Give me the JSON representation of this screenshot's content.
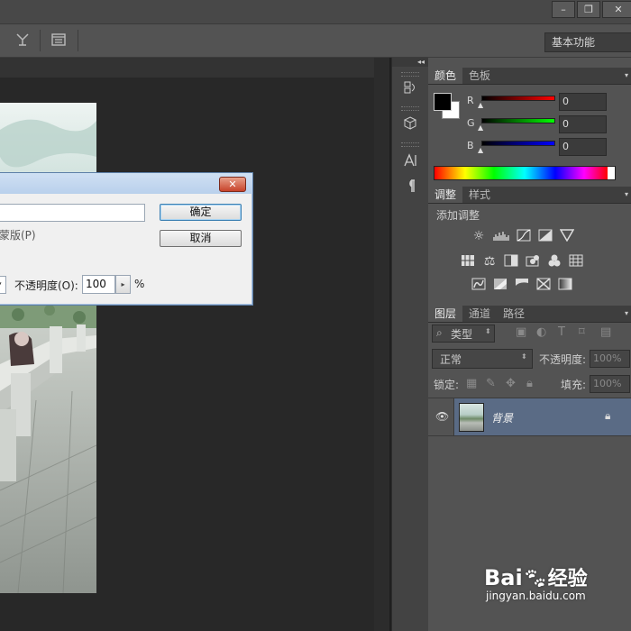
{
  "app": {
    "workspace": "基本功能",
    "window_controls": [
      "–",
      "❐",
      "✕"
    ]
  },
  "color_panel": {
    "tabs": [
      "颜色",
      "色板"
    ],
    "channels": [
      {
        "label": "R",
        "value": "0",
        "color": "#d01818"
      },
      {
        "label": "G",
        "value": "0",
        "color": "#1aa81a"
      },
      {
        "label": "B",
        "value": "0",
        "color": "#1a1ad0"
      }
    ]
  },
  "adjustments_panel": {
    "tabs": [
      "调整",
      "样式"
    ],
    "heading": "添加调整",
    "row1_icons": [
      "brightness-icon",
      "levels-icon",
      "curves-icon",
      "exposure-icon",
      "triangle-icon"
    ],
    "row2_icons": [
      "vibrance-icon",
      "balance-icon",
      "bw-icon",
      "photo-filter-icon",
      "channel-mixer-icon",
      "color-lookup-icon"
    ],
    "row3_icons": [
      "invert-icon",
      "posterize-icon",
      "threshold-icon",
      "selective-color-icon",
      "gradient-map-icon"
    ]
  },
  "layers_panel": {
    "tabs": [
      "图层",
      "通道",
      "路径"
    ],
    "filter_kind": "类型",
    "blend_mode": "正常",
    "opacity_label": "不透明度:",
    "opacity_value": "100%",
    "lock_label": "锁定:",
    "fill_label": "填充:",
    "fill_value": "100%",
    "layers": [
      {
        "name": "背景",
        "visible": true,
        "locked": true
      }
    ]
  },
  "dialog": {
    "ok_label": "确定",
    "cancel_label": "取消",
    "mask_label": "蒙版(P)",
    "opacity_label": "不透明度(O):",
    "opacity_value": "100",
    "percent": "%",
    "close_glyph": "✕"
  },
  "watermark": {
    "brand": "Bai",
    "brand_tail": "经验",
    "url": "jingyan.baidu.com"
  }
}
